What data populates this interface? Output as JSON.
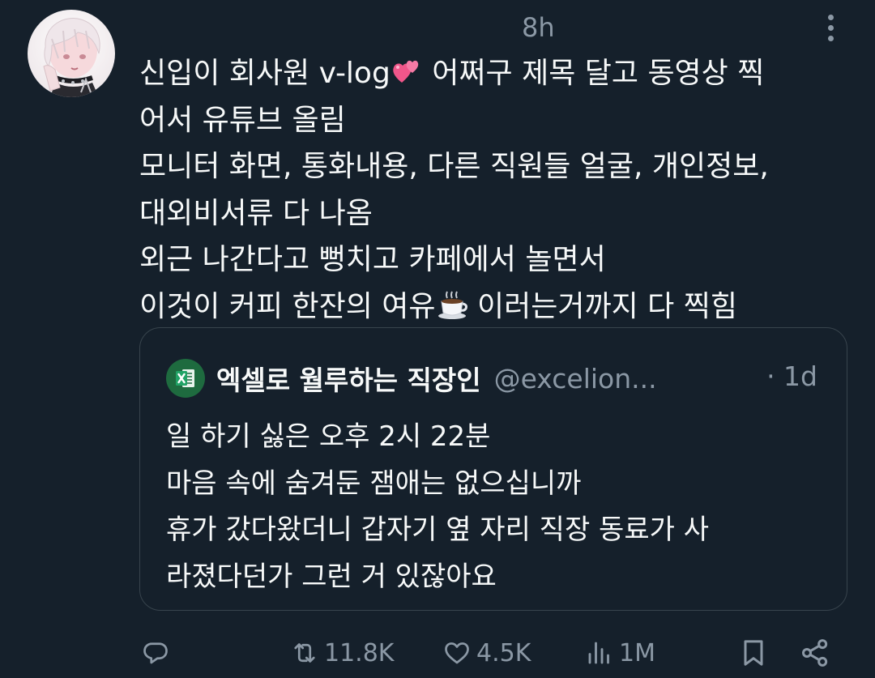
{
  "tweet": {
    "timestamp": "8h",
    "lines": [
      {
        "before": "신입이 회사원 v-log",
        "emoji": "two-hearts",
        "after": " 어쩌구 제목 달고 동영상 찍"
      },
      {
        "before": "어서 유튜브 올림",
        "emoji": null,
        "after": ""
      },
      {
        "before": "모니터 화면, 통화내용, 다른 직원들 얼굴, 개인정보,",
        "emoji": null,
        "after": ""
      },
      {
        "before": "대외비서류 다 나옴",
        "emoji": null,
        "after": ""
      },
      {
        "before": "외근 나간다고 뻥치고 카페에서 놀면서",
        "emoji": null,
        "after": ""
      },
      {
        "before": "이것이 커피 한잔의 여유",
        "emoji": "hot-beverage",
        "after": " 이러는거까지 다 찍힘"
      }
    ]
  },
  "quoted": {
    "name": "엑셀로 월루하는 직장인",
    "handle": "@excelion...",
    "time": "· 1d",
    "lines": [
      "일 하기 싫은 오후 2시 22분",
      "마음 속에 숨겨둔 잼애는 없으십니까",
      "휴가 갔다왔더니 갑자기 옆 자리 직장 동료가 사",
      "라졌다던가 그런 거 있잖아요"
    ]
  },
  "actions": {
    "reply": "",
    "retweet": "11.8K",
    "like": "4.5K",
    "views": "1M"
  },
  "colors": {
    "background": "#15202b",
    "text": "#f7f9f9",
    "secondary": "#8b98a5",
    "border": "#38444d",
    "excel_green": "#1e6b3f"
  },
  "icons": [
    "more-vertical-icon",
    "two-hearts-emoji",
    "hot-beverage-emoji",
    "excel-icon",
    "reply-icon",
    "retweet-icon",
    "heart-icon",
    "views-icon",
    "bookmark-icon",
    "share-icon"
  ]
}
